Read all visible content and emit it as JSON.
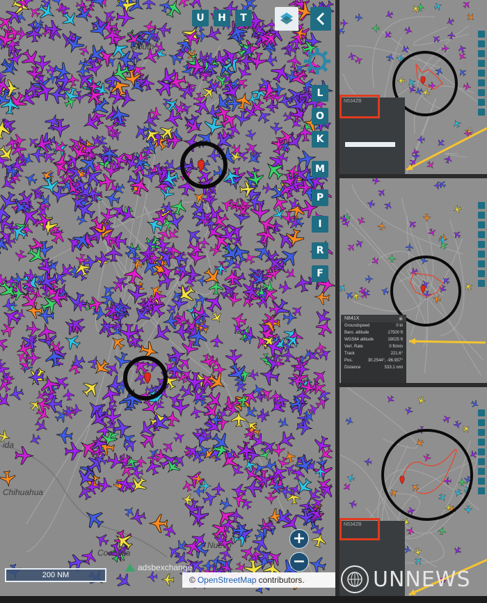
{
  "toolbar": {
    "top_buttons": [
      "U",
      "H",
      "T"
    ],
    "side_buttons": [
      "L",
      "O",
      "K",
      "M",
      "P",
      "I",
      "R",
      "F"
    ],
    "layers_icon": "layers-icon",
    "collapse_icon": "chevron-left-icon",
    "settings_icon": "gear-icon"
  },
  "map": {
    "labels": {
      "south": "South",
      "chihuahua": "Chihuahua",
      "coahuila": "Coahuila",
      "nuevo": "Nuevo",
      "mo": "Mo",
      "ida": "ida"
    },
    "scale": "200 NM",
    "attribution_prefix": "©",
    "attribution_link": "OpenStreetMap",
    "attribution_suffix": "contributors.",
    "brand": "adsbexchange",
    "zoom_in": "+",
    "zoom_out": "−",
    "marker_icon": "map-pin-icon",
    "colors": {
      "background": "#8c8c8c",
      "aircraft": [
        "#8a2be2",
        "#a020f0",
        "#c71ed8",
        "#6a3cf0",
        "#3f5de8",
        "#e01ec8",
        "#f0e040",
        "#3ad46a",
        "#2ec4e8",
        "#ff8a1e"
      ]
    }
  },
  "panels": [
    {
      "red_label": "N534ZB",
      "red_label_sub": "",
      "arrow": "arrow-icon"
    },
    {
      "info_title": "N841X",
      "rows": [
        {
          "label": "Groundspeed",
          "value": "0 kt"
        },
        {
          "label": "Baro. altitude",
          "value": "17500 ft"
        },
        {
          "label": "WGS84 altitude",
          "value": "18025 ft"
        },
        {
          "label": "Vert. Rate",
          "value": "0 ft/min"
        },
        {
          "label": "Track",
          "value": "221.6°"
        },
        {
          "label": "Pos.",
          "value": "30.2544°, -96.937°"
        },
        {
          "label": "Distance",
          "value": "533.1 nmi"
        }
      ]
    },
    {
      "red_label": "N534ZB",
      "red_label_sub": "",
      "arrow": "arrow-icon"
    }
  ],
  "watermark": {
    "text": "UNNEWS",
    "logo": "un-emblem-icon"
  }
}
